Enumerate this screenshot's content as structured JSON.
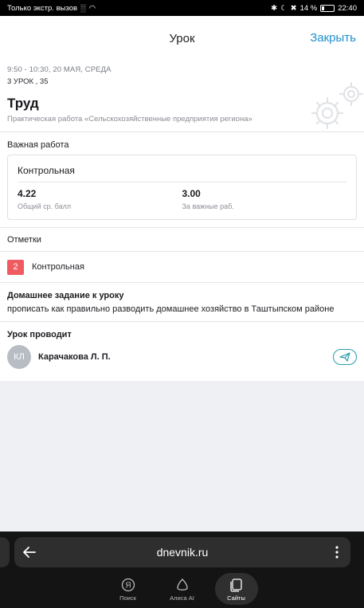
{
  "statusbar": {
    "carrier": "Только экстр. вызов",
    "battery": "14 %",
    "time": "22:40"
  },
  "header": {
    "title": "Урок",
    "close": "Закрыть"
  },
  "lesson": {
    "datetime": "9:50 - 10:30, 20 МАЯ, СРЕДА",
    "number": "3 УРОК , 35",
    "subject": "Труд",
    "topic": "Практическая работа «Сельскохозяйственные предприятия региона»"
  },
  "important": {
    "label": "Важная работа",
    "card_title": "Контрольная",
    "stats": [
      {
        "value": "4.22",
        "label": "Общий ср. балл"
      },
      {
        "value": "3.00",
        "label": "За важные раб."
      }
    ]
  },
  "marks": {
    "label": "Отметки",
    "items": [
      {
        "value": "2",
        "label": "Контрольная",
        "color": "#ef5b61"
      }
    ]
  },
  "homework": {
    "label": "Домашнее задание к уроку",
    "text": "прописать как правильно разводить домашнее хозяйство в Таштыпском районе"
  },
  "teacher": {
    "label": "Урок проводит",
    "initials": "КЛ",
    "name": "Карачакова Л. П."
  },
  "browser": {
    "url": "dnevnik.ru",
    "nav": [
      {
        "label": "Поиск",
        "icon": "yandex-search-icon"
      },
      {
        "label": "Алиса AI",
        "icon": "alice-icon"
      },
      {
        "label": "Сайты",
        "icon": "sites-icon",
        "active": true
      }
    ]
  },
  "colors": {
    "accent": "#1f8fcf",
    "mark_bad": "#ef5b61",
    "teal": "#2a9ca8"
  }
}
